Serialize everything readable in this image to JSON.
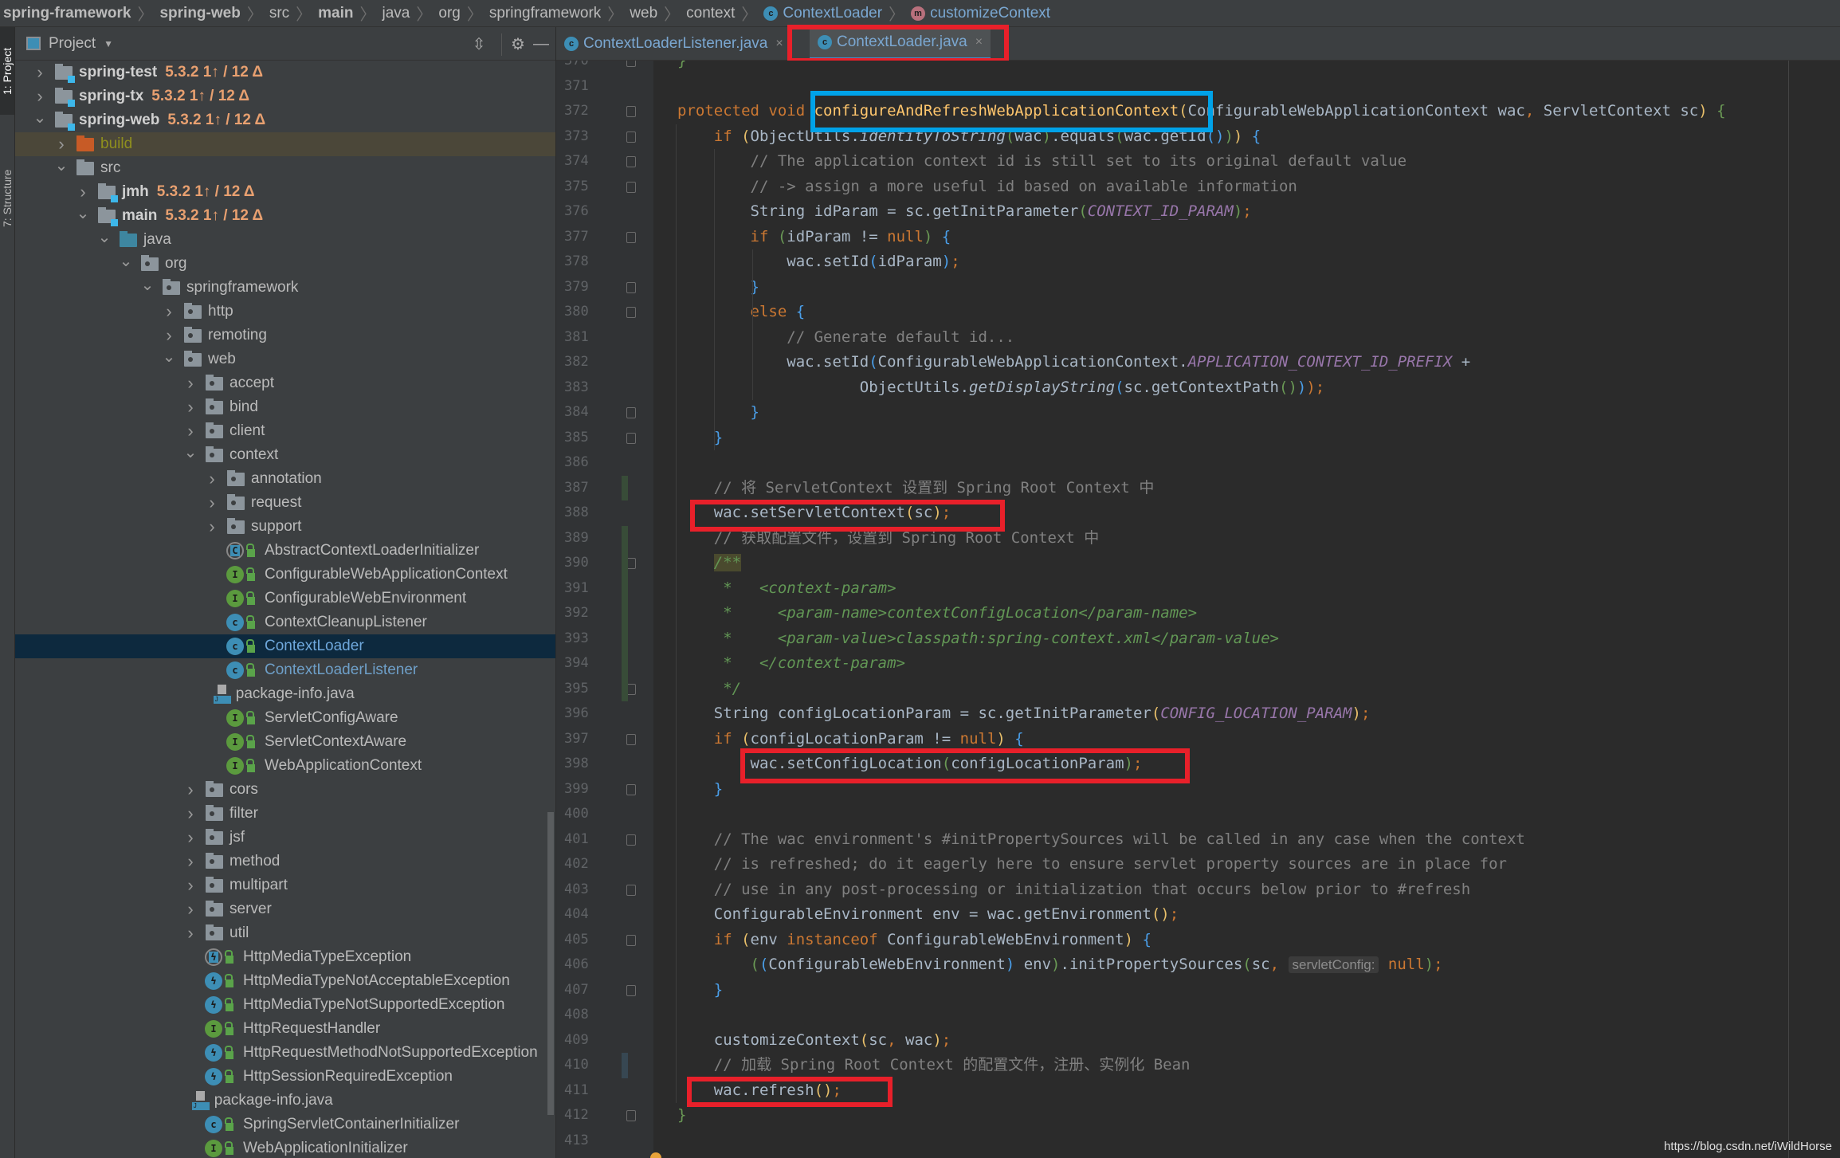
{
  "breadcrumb": [
    {
      "label": "spring-framework",
      "bold": true
    },
    {
      "label": "spring-web",
      "bold": true
    },
    {
      "label": "src",
      "bold": false
    },
    {
      "label": "main",
      "bold": true
    },
    {
      "label": "java",
      "bold": false
    },
    {
      "label": "org",
      "bold": false
    },
    {
      "label": "springframework",
      "bold": false
    },
    {
      "label": "web",
      "bold": false
    },
    {
      "label": "context",
      "bold": false
    },
    {
      "label": "ContextLoader",
      "icon": "class-icon",
      "icon_glyph": "c"
    },
    {
      "label": "customizeContext",
      "icon": "method-icon",
      "icon_glyph": "m"
    }
  ],
  "toolstrip": {
    "project_tab": "1: Project",
    "structure_tab": "7: Structure"
  },
  "project_panel": {
    "title": "Project",
    "version_suffix": "5.3.2 1↑ / 12 Δ",
    "rows": [
      {
        "label": "spring-test",
        "type": "module",
        "expanded": false,
        "depth": 0,
        "bold": true,
        "version": true
      },
      {
        "label": "spring-tx",
        "type": "module",
        "expanded": false,
        "depth": 0,
        "bold": true,
        "version": true
      },
      {
        "label": "spring-web",
        "type": "module",
        "expanded": true,
        "depth": 0,
        "bold": true,
        "version": true
      },
      {
        "label": "build",
        "type": "build",
        "expanded": false,
        "depth": 1,
        "highlight": true
      },
      {
        "label": "src",
        "type": "folder",
        "expanded": true,
        "depth": 1
      },
      {
        "label": "jmh",
        "type": "module",
        "expanded": false,
        "depth": 2,
        "bold": true,
        "version": true
      },
      {
        "label": "main",
        "type": "module",
        "expanded": true,
        "depth": 2,
        "bold": true,
        "version": true
      },
      {
        "label": "java",
        "type": "src",
        "expanded": true,
        "depth": 3
      },
      {
        "label": "org",
        "type": "pkg",
        "expanded": true,
        "depth": 4
      },
      {
        "label": "springframework",
        "type": "pkg",
        "expanded": true,
        "depth": 5
      },
      {
        "label": "http",
        "type": "pkg",
        "expanded": false,
        "depth": 6
      },
      {
        "label": "remoting",
        "type": "pkg",
        "expanded": false,
        "depth": 6
      },
      {
        "label": "web",
        "type": "pkg",
        "expanded": true,
        "depth": 6
      },
      {
        "label": "accept",
        "type": "pkg",
        "expanded": false,
        "depth": 7
      },
      {
        "label": "bind",
        "type": "pkg",
        "expanded": false,
        "depth": 7
      },
      {
        "label": "client",
        "type": "pkg",
        "expanded": false,
        "depth": 7
      },
      {
        "label": "context",
        "type": "pkg",
        "expanded": true,
        "depth": 7
      },
      {
        "label": "annotation",
        "type": "pkg",
        "expanded": false,
        "depth": 8
      },
      {
        "label": "request",
        "type": "pkg",
        "expanded": false,
        "depth": 8
      },
      {
        "label": "support",
        "type": "pkg",
        "expanded": false,
        "depth": 8
      },
      {
        "label": "AbstractContextLoaderInitializer",
        "type": "abstract",
        "depth": 9
      },
      {
        "label": "ConfigurableWebApplicationContext",
        "type": "interface",
        "depth": 9
      },
      {
        "label": "ConfigurableWebEnvironment",
        "type": "interface",
        "depth": 9
      },
      {
        "label": "ContextCleanupListener",
        "type": "class",
        "depth": 9
      },
      {
        "label": "ContextLoader",
        "type": "class",
        "depth": 9,
        "selected": true
      },
      {
        "label": "ContextLoaderListener",
        "type": "class",
        "depth": 9,
        "open": true
      },
      {
        "label": "package-info.java",
        "type": "file",
        "depth": 8.4
      },
      {
        "label": "ServletConfigAware",
        "type": "interface",
        "depth": 9
      },
      {
        "label": "ServletContextAware",
        "type": "interface",
        "depth": 9
      },
      {
        "label": "WebApplicationContext",
        "type": "interface",
        "depth": 9
      },
      {
        "label": "cors",
        "type": "pkg",
        "expanded": false,
        "depth": 7
      },
      {
        "label": "filter",
        "type": "pkg",
        "expanded": false,
        "depth": 7
      },
      {
        "label": "jsf",
        "type": "pkg",
        "expanded": false,
        "depth": 7
      },
      {
        "label": "method",
        "type": "pkg",
        "expanded": false,
        "depth": 7
      },
      {
        "label": "multipart",
        "type": "pkg",
        "expanded": false,
        "depth": 7
      },
      {
        "label": "server",
        "type": "pkg",
        "expanded": false,
        "depth": 7
      },
      {
        "label": "util",
        "type": "pkg",
        "expanded": false,
        "depth": 7
      },
      {
        "label": "HttpMediaTypeException",
        "type": "abstract-exception",
        "depth": 8
      },
      {
        "label": "HttpMediaTypeNotAcceptableException",
        "type": "exception",
        "depth": 8
      },
      {
        "label": "HttpMediaTypeNotSupportedException",
        "type": "exception",
        "depth": 8
      },
      {
        "label": "HttpRequestHandler",
        "type": "interface",
        "depth": 8
      },
      {
        "label": "HttpRequestMethodNotSupportedException",
        "type": "exception",
        "depth": 8
      },
      {
        "label": "HttpSessionRequiredException",
        "type": "exception",
        "depth": 8
      },
      {
        "label": "package-info.java",
        "type": "file",
        "depth": 7.4
      },
      {
        "label": "SpringServletContainerInitializer",
        "type": "class",
        "depth": 8
      },
      {
        "label": "WebApplicationInitializer",
        "type": "interface",
        "depth": 8
      }
    ]
  },
  "tabs": [
    {
      "label": "ContextLoaderListener.java",
      "active": false
    },
    {
      "label": "ContextLoader.java",
      "active": true
    }
  ],
  "editor": {
    "first_line": 370,
    "lines": [
      {
        "n": "370",
        "tokens": [
          [
            "}",
            "par2"
          ]
        ]
      },
      {
        "n": "371",
        "tokens": []
      },
      {
        "n": "372",
        "tokens": [
          [
            "protected void ",
            "kw"
          ],
          [
            "configureAndRefreshWebApplicationContext",
            "fn"
          ],
          [
            "(",
            "par1"
          ],
          [
            "ConfigurableWebApplicationContext wac",
            ""
          ],
          [
            ", ",
            "semi"
          ],
          [
            "ServletContext sc",
            ""
          ],
          [
            ")",
            "par1"
          ],
          [
            " {",
            "par2"
          ]
        ]
      },
      {
        "n": "373",
        "tokens": [
          [
            "    if ",
            "kw"
          ],
          [
            "(",
            "par1"
          ],
          [
            "ObjectUtils.",
            ""
          ],
          [
            "identityToString",
            "italic"
          ],
          [
            "(",
            "par2"
          ],
          [
            "wac",
            ""
          ],
          [
            ")",
            "par2"
          ],
          [
            ".equals",
            ""
          ],
          [
            "(",
            "par2"
          ],
          [
            "wac.getId",
            ""
          ],
          [
            "()",
            "par3"
          ],
          [
            ")",
            "par2"
          ],
          [
            ")",
            "par1"
          ],
          [
            " {",
            "par3"
          ]
        ]
      },
      {
        "n": "374",
        "tokens": [
          [
            "        // The application context id is still set to its original default value",
            "cm"
          ]
        ]
      },
      {
        "n": "375",
        "tokens": [
          [
            "        // -> assign a more useful id based on available information",
            "cm"
          ]
        ]
      },
      {
        "n": "376",
        "tokens": [
          [
            "        String idParam = sc.getInitParameter",
            ""
          ],
          [
            "(",
            "par2"
          ],
          [
            "CONTEXT_ID_PARAM",
            "const"
          ],
          [
            ")",
            "par2"
          ],
          [
            ";",
            "semi"
          ]
        ]
      },
      {
        "n": "377",
        "tokens": [
          [
            "        if ",
            "kw"
          ],
          [
            "(",
            "par2"
          ],
          [
            "idParam != ",
            ""
          ],
          [
            "null",
            "kw"
          ],
          [
            ")",
            "par2"
          ],
          [
            " {",
            "par3"
          ]
        ]
      },
      {
        "n": "378",
        "tokens": [
          [
            "            wac.setId",
            ""
          ],
          [
            "(",
            "par3"
          ],
          [
            "idParam",
            ""
          ],
          [
            ")",
            "par3"
          ],
          [
            ";",
            "semi"
          ]
        ]
      },
      {
        "n": "379",
        "tokens": [
          [
            "        }",
            "par3"
          ]
        ]
      },
      {
        "n": "380",
        "tokens": [
          [
            "        else ",
            "kw"
          ],
          [
            "{",
            "par3"
          ]
        ]
      },
      {
        "n": "381",
        "tokens": [
          [
            "            // Generate default id...",
            "cm"
          ]
        ]
      },
      {
        "n": "382",
        "tokens": [
          [
            "            wac.setId",
            ""
          ],
          [
            "(",
            "par3"
          ],
          [
            "ConfigurableWebApplicationContext.",
            ""
          ],
          [
            "APPLICATION_CONTEXT_ID_PREFIX",
            "const"
          ],
          [
            " +",
            ""
          ]
        ]
      },
      {
        "n": "383",
        "tokens": [
          [
            "                    ObjectUtils.",
            ""
          ],
          [
            "getDisplayString",
            "italic"
          ],
          [
            "(",
            "par3"
          ],
          [
            "sc.getContextPath",
            ""
          ],
          [
            "()",
            "par2"
          ],
          [
            ")",
            "par3"
          ],
          [
            ");",
            "semi"
          ]
        ]
      },
      {
        "n": "384",
        "tokens": [
          [
            "        }",
            "par3"
          ]
        ]
      },
      {
        "n": "385",
        "tokens": [
          [
            "    }",
            "par3"
          ]
        ]
      },
      {
        "n": "386",
        "tokens": []
      },
      {
        "n": "387",
        "tokens": [
          [
            "    // 将 ServletContext 设置到 Spring Root Context 中",
            "cm"
          ]
        ]
      },
      {
        "n": "388",
        "tokens": [
          [
            "    wac.setServletContext",
            ""
          ],
          [
            "(",
            "par1"
          ],
          [
            "sc",
            ""
          ],
          [
            ")",
            "par1"
          ],
          [
            ";",
            "semi"
          ]
        ]
      },
      {
        "n": "389",
        "tokens": [
          [
            "    // 获取配置文件，设置到 Spring Root Context 中",
            "cm"
          ]
        ]
      },
      {
        "n": "390",
        "tokens": [
          [
            "    ",
            ""
          ],
          [
            "/**",
            "doc docstart"
          ]
        ]
      },
      {
        "n": "391",
        "tokens": [
          [
            "     *   <context-param>",
            "doc"
          ]
        ]
      },
      {
        "n": "392",
        "tokens": [
          [
            "     *     <param-name>contextConfigLocation</param-name>",
            "doc"
          ]
        ]
      },
      {
        "n": "393",
        "tokens": [
          [
            "     *     <param-value>classpath:spring-context.xml</param-value>",
            "doc"
          ]
        ]
      },
      {
        "n": "394",
        "tokens": [
          [
            "     *   </context-param>",
            "doc"
          ]
        ]
      },
      {
        "n": "395",
        "tokens": [
          [
            "     */",
            "doc"
          ]
        ]
      },
      {
        "n": "396",
        "tokens": [
          [
            "    String configLocationParam = sc.getInitParameter",
            ""
          ],
          [
            "(",
            "par1"
          ],
          [
            "CONFIG_LOCATION_PARAM",
            "const"
          ],
          [
            ")",
            "par1"
          ],
          [
            ";",
            "semi"
          ]
        ]
      },
      {
        "n": "397",
        "tokens": [
          [
            "    if ",
            "kw"
          ],
          [
            "(",
            "par1"
          ],
          [
            "configLocationParam != ",
            ""
          ],
          [
            "null",
            "kw"
          ],
          [
            ")",
            "par1"
          ],
          [
            " {",
            "par3"
          ]
        ]
      },
      {
        "n": "398",
        "tokens": [
          [
            "        wac.setConfigLocation",
            ""
          ],
          [
            "(",
            "par2"
          ],
          [
            "configLocationParam",
            ""
          ],
          [
            ")",
            "par2"
          ],
          [
            ";",
            "semi"
          ]
        ]
      },
      {
        "n": "399",
        "tokens": [
          [
            "    }",
            "par3"
          ]
        ]
      },
      {
        "n": "400",
        "tokens": []
      },
      {
        "n": "401",
        "tokens": [
          [
            "    // The wac environment's #initPropertySources will be called in any case when the context",
            "cm"
          ]
        ]
      },
      {
        "n": "402",
        "tokens": [
          [
            "    // is refreshed; do it eagerly here to ensure servlet property sources are in place for",
            "cm"
          ]
        ]
      },
      {
        "n": "403",
        "tokens": [
          [
            "    // use in any post-processing or initialization that occurs below prior to #refresh",
            "cm"
          ]
        ]
      },
      {
        "n": "404",
        "tokens": [
          [
            "    ConfigurableEnvironment env = wac.getEnvironment",
            ""
          ],
          [
            "()",
            "par1"
          ],
          [
            ";",
            "semi"
          ]
        ]
      },
      {
        "n": "405",
        "tokens": [
          [
            "    if ",
            "kw"
          ],
          [
            "(",
            "par1"
          ],
          [
            "env ",
            ""
          ],
          [
            "instanceof ",
            "kw"
          ],
          [
            "ConfigurableWebEnvironment",
            ""
          ],
          [
            ")",
            "par1"
          ],
          [
            " {",
            "par3"
          ]
        ]
      },
      {
        "n": "406",
        "tokens": [
          [
            "        (",
            "par2"
          ],
          [
            "(",
            "par3"
          ],
          [
            "ConfigurableWebEnvironment",
            ""
          ],
          [
            ")",
            "par3"
          ],
          [
            " env",
            ""
          ],
          [
            ")",
            "par2"
          ],
          [
            ".initPropertySources",
            ""
          ],
          [
            "(",
            "par2"
          ],
          [
            "sc",
            ""
          ],
          [
            ", ",
            "semi"
          ],
          [
            "servletConfig:",
            "hint"
          ],
          [
            " null",
            "kw"
          ],
          [
            ")",
            "par2"
          ],
          [
            ";",
            "semi"
          ]
        ]
      },
      {
        "n": "407",
        "tokens": [
          [
            "    }",
            "par3"
          ]
        ]
      },
      {
        "n": "408",
        "tokens": []
      },
      {
        "n": "409",
        "tokens": [
          [
            "    customizeContext",
            ""
          ],
          [
            "(",
            "par1"
          ],
          [
            "sc",
            ""
          ],
          [
            ", ",
            "semi"
          ],
          [
            "wac",
            ""
          ],
          [
            ")",
            "par1"
          ],
          [
            ";",
            "semi"
          ]
        ]
      },
      {
        "n": "410",
        "tokens": [
          [
            "    // 加载 Spring Root Context 的配置文件，注册、实例化 Bean",
            "cm"
          ]
        ]
      },
      {
        "n": "411",
        "tokens": [
          [
            "    wac.refresh",
            ""
          ],
          [
            "()",
            "par1"
          ],
          [
            ";",
            "semi"
          ]
        ]
      },
      {
        "n": "412",
        "tokens": [
          [
            "}",
            "par2"
          ]
        ]
      },
      {
        "n": "413",
        "tokens": []
      }
    ]
  },
  "annotations": {
    "red_box_color": "#e8202a",
    "blue_box_color": "#00a2e8"
  },
  "watermark": "https://blog.csdn.net/iWildHorse"
}
